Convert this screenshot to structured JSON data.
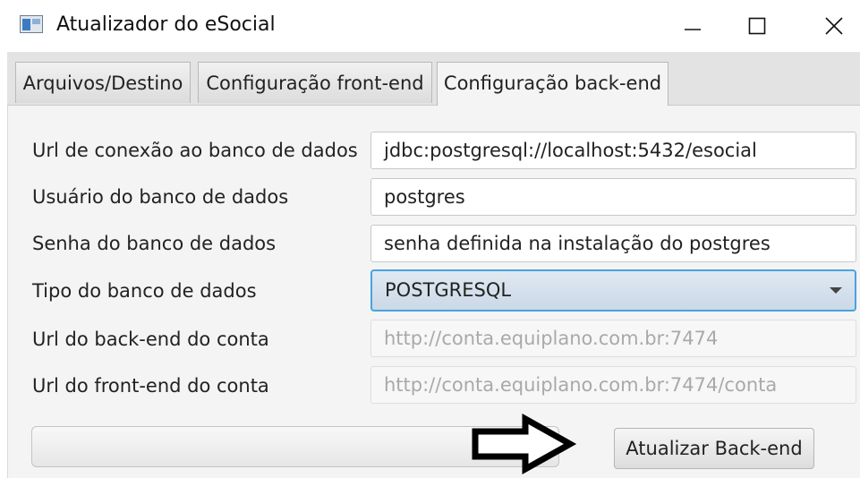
{
  "window": {
    "title": "Atualizador do eSocial"
  },
  "tabs": [
    {
      "label": "Arquivos/Destino"
    },
    {
      "label": "Configuração front-end"
    },
    {
      "label": "Configuração back-end",
      "selected": true
    }
  ],
  "form": {
    "db_url": {
      "label": "Url de conexão ao banco de dados",
      "value": "jdbc:postgresql://localhost:5432/esocial"
    },
    "db_user": {
      "label": "Usuário do banco de dados",
      "value": "postgres"
    },
    "db_password": {
      "label": "Senha do banco de dados",
      "value": "senha definida na instalação do postgres"
    },
    "db_type": {
      "label": "Tipo do banco de dados",
      "selected": "POSTGRESQL"
    },
    "backend_url": {
      "label": "Url do back-end do conta",
      "placeholder": "http://conta.equiplano.com.br:7474"
    },
    "frontend_url": {
      "label": "Url do front-end do conta",
      "placeholder": "http://conta.equiplano.com.br:7474/conta"
    }
  },
  "footer": {
    "progress": 0,
    "action_label": "Atualizar Back-end"
  },
  "icons": {
    "app": "app-window-icon",
    "arrow": "right-arrow-icon"
  }
}
